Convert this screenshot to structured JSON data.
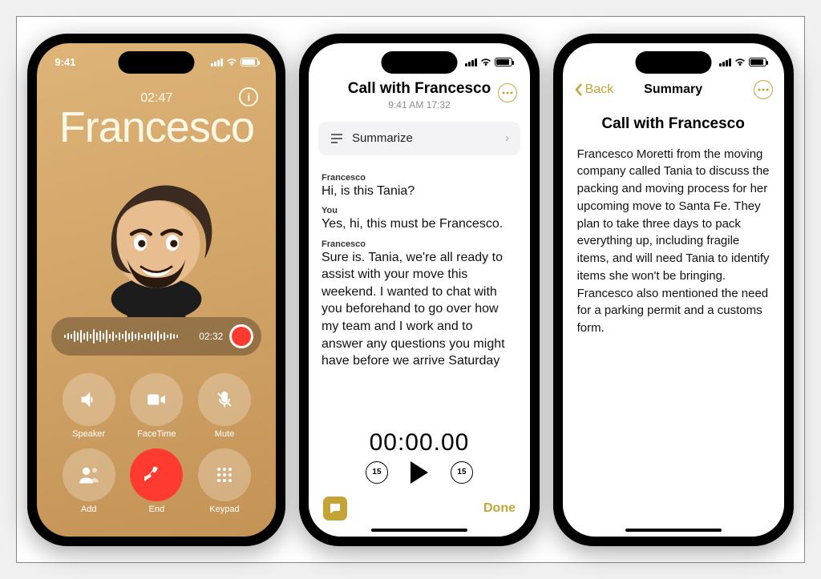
{
  "statusTime": "9:41",
  "phone1": {
    "duration": "02:47",
    "caller": "Francesco",
    "recTime": "02:32",
    "info": "i",
    "buttons": {
      "speaker": "Speaker",
      "facetime": "FaceTime",
      "mute": "Mute",
      "add": "Add",
      "end": "End",
      "keypad": "Keypad"
    }
  },
  "phone2": {
    "title": "Call with Francesco",
    "subtitle": "9:41 AM  17:32",
    "summarize": "Summarize",
    "timer": "00:00.00",
    "skip": "15",
    "done": "Done",
    "t": [
      {
        "sp": "Francesco",
        "tx": "Hi, is this Tania?"
      },
      {
        "sp": "You",
        "tx": "Yes, hi, this must be Francesco."
      },
      {
        "sp": "Francesco",
        "tx": "Sure is. Tania, we're all ready to assist with your move this weekend. I wanted to chat with you beforehand to go over how my team and I work and to answer any questions you might have before we arrive Saturday"
      }
    ]
  },
  "phone3": {
    "back": "Back",
    "navTitle": "Summary",
    "title": "Call with Francesco",
    "body": "Francesco Moretti from the moving company called Tania to discuss the packing and moving process for her upcoming move to Santa Fe. They plan to take three days to pack everything up, including fragile items, and will need Tania to identify items she won't be bringing. Francesco also mentioned the need for a parking permit and a customs form."
  }
}
